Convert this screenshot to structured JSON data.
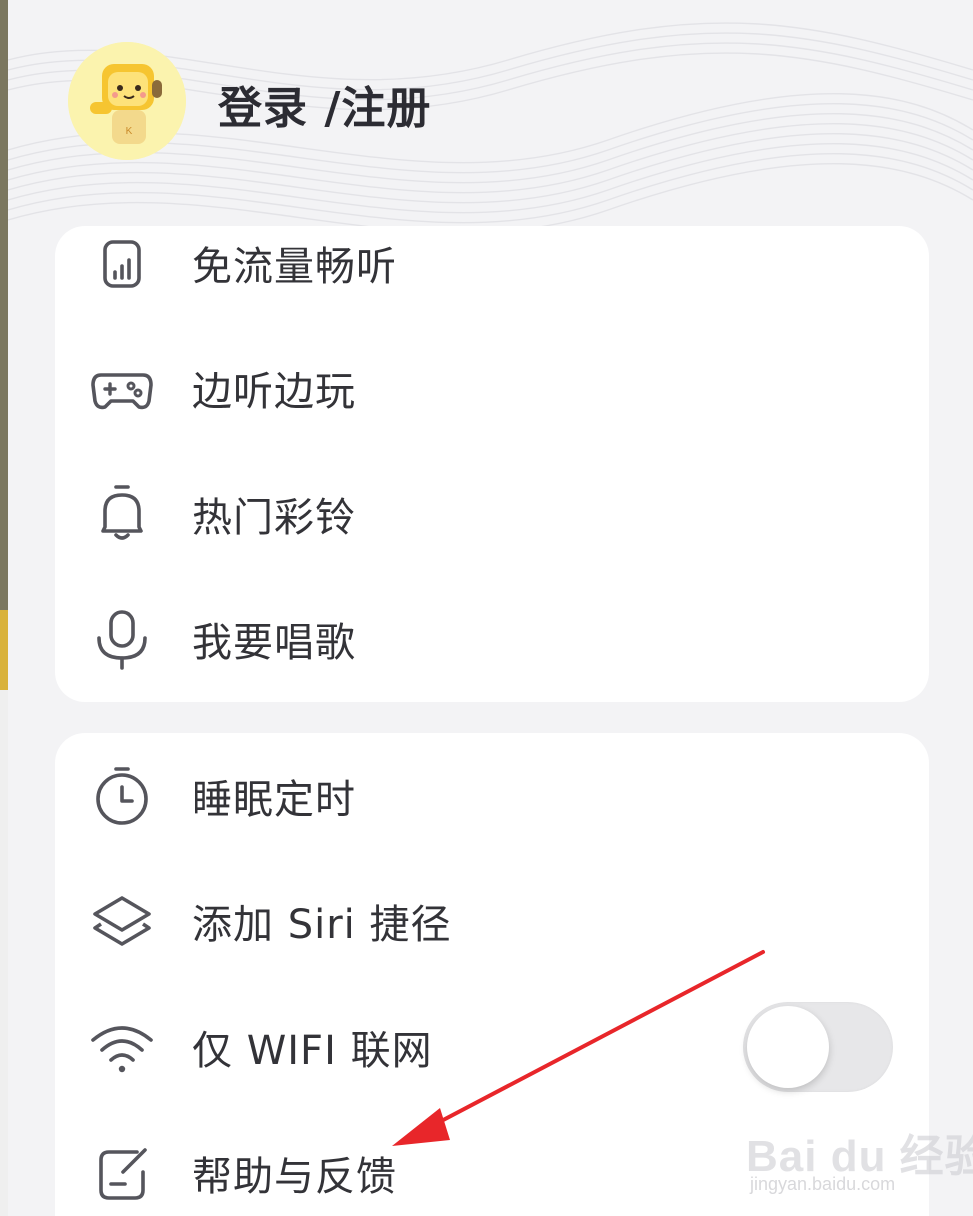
{
  "header": {
    "login_label": "登录 /注册"
  },
  "menu_group_1": [
    {
      "label": "免流量畅听",
      "icon": "data-bars-icon"
    },
    {
      "label": "边听边玩",
      "icon": "gamepad-icon"
    },
    {
      "label": "热门彩铃",
      "icon": "bell-icon"
    },
    {
      "label": "我要唱歌",
      "icon": "microphone-icon"
    }
  ],
  "menu_group_2": [
    {
      "label": "睡眠定时",
      "icon": "timer-icon"
    },
    {
      "label": "添加 Siri 捷径",
      "icon": "layers-icon"
    },
    {
      "label": "仅 WIFI 联网",
      "icon": "wifi-icon",
      "toggle": false
    },
    {
      "label": "帮助与反馈",
      "icon": "feedback-icon"
    }
  ],
  "annotation": {
    "arrow_color": "#e8262a"
  },
  "watermark": {
    "main": "Bai du 经验",
    "sub": "jingyan.baidu.com"
  }
}
